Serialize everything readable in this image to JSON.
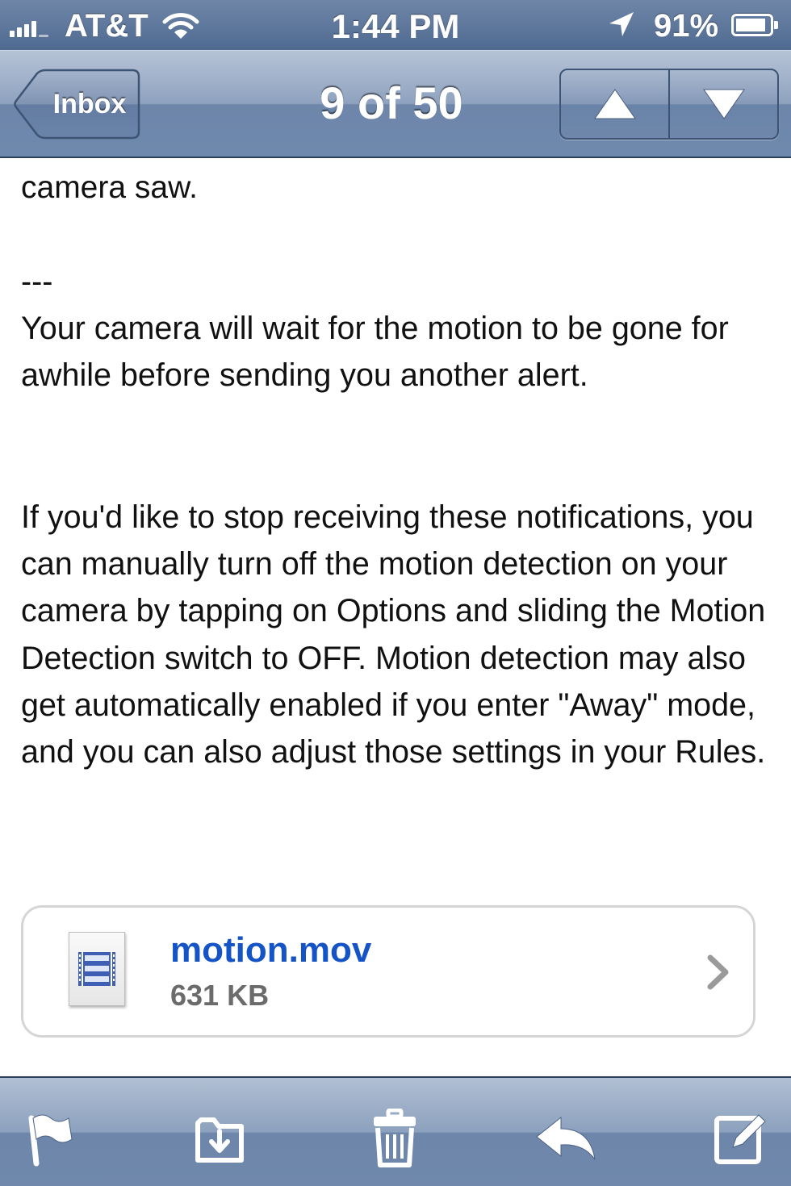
{
  "status_bar": {
    "carrier": "AT&T",
    "time": "1:44 PM",
    "battery_percent": "91%",
    "battery_level": 0.91,
    "icons": [
      "signal-icon",
      "wifi-icon",
      "location-icon",
      "battery-icon"
    ]
  },
  "nav": {
    "back_label": "Inbox",
    "title": "9 of 50",
    "prev_icon": "up-arrow-icon",
    "next_icon": "down-arrow-icon"
  },
  "message": {
    "cut_off_text": "camera saw.",
    "separator": "---",
    "paragraph_1": "Your camera will wait for the motion to be gone for awhile before sending you another alert.",
    "paragraph_2": "If you'd like to stop receiving these notifications, you can manually turn off the motion detection on your camera by tapping on Options and sliding the Motion Detection switch to OFF. Motion detection may also get automatically enabled if you enter \"Away\" mode, and you can also adjust those settings in your Rules."
  },
  "attachment": {
    "file_name": "motion.mov",
    "file_size": "631 KB",
    "icon": "movie-file-icon"
  },
  "toolbar": {
    "icons": [
      "flag-icon",
      "move-to-folder-icon",
      "trash-icon",
      "reply-icon",
      "compose-icon"
    ]
  },
  "colors": {
    "bar_blue": "#6f88ad",
    "link_blue": "#1554c7",
    "text": "#111111"
  }
}
